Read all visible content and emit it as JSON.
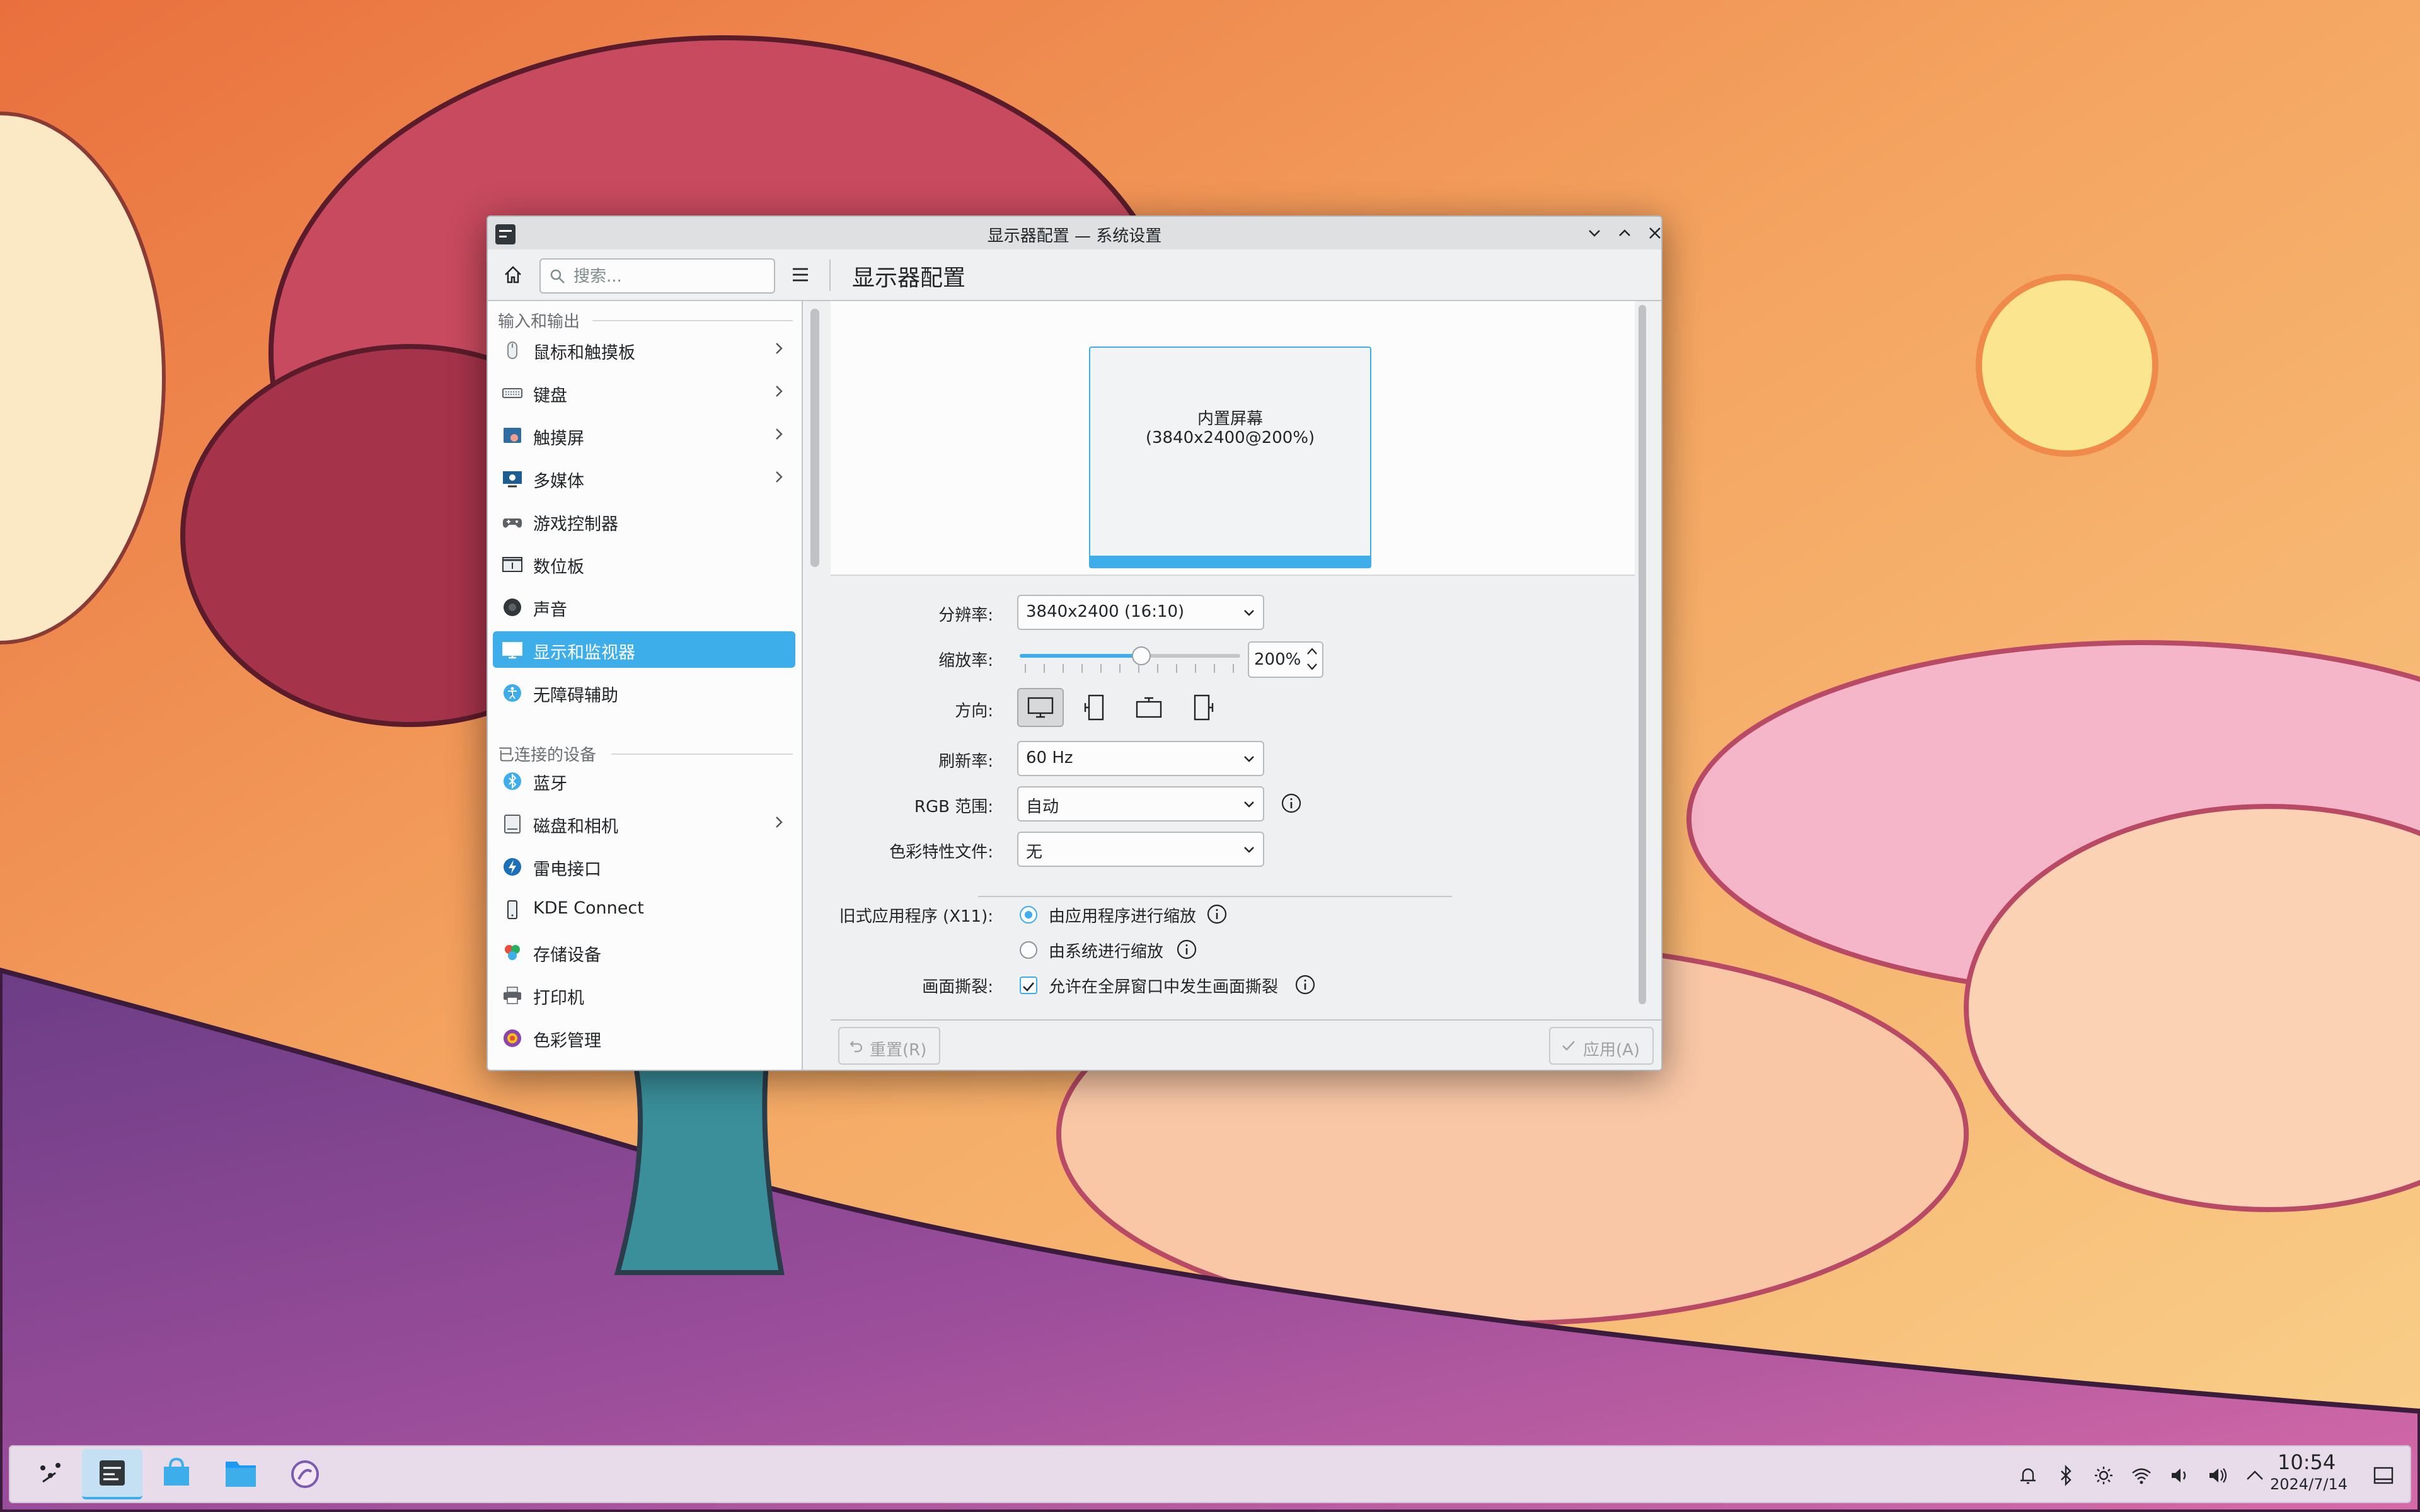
{
  "window": {
    "title": "显示器配置 — 系统设置",
    "page_title": "显示器配置",
    "search_placeholder": "搜索..."
  },
  "sidebar": {
    "section_input_output": "输入和输出",
    "section_connected": "已连接的设备",
    "items_io": [
      {
        "label": "鼠标和触摸板",
        "icon": "mouse-icon",
        "chevron": true
      },
      {
        "label": "键盘",
        "icon": "keyboard-icon",
        "chevron": true
      },
      {
        "label": "触摸屏",
        "icon": "touchscreen-icon",
        "chevron": true
      },
      {
        "label": "多媒体",
        "icon": "multimedia-icon",
        "chevron": true
      },
      {
        "label": "游戏控制器",
        "icon": "gamepad-icon",
        "chevron": false
      },
      {
        "label": "数位板",
        "icon": "tablet-icon",
        "chevron": false
      },
      {
        "label": "声音",
        "icon": "speaker-icon",
        "chevron": false
      },
      {
        "label": "显示和监视器",
        "icon": "display-icon",
        "chevron": false,
        "active": true
      },
      {
        "label": "无障碍辅助",
        "icon": "accessibility-icon",
        "chevron": false
      }
    ],
    "items_connected": [
      {
        "label": "蓝牙",
        "icon": "bluetooth-icon",
        "chevron": false
      },
      {
        "label": "磁盘和相机",
        "icon": "disk-icon",
        "chevron": true
      },
      {
        "label": "雷电接口",
        "icon": "thunderbolt-icon",
        "chevron": false
      },
      {
        "label": "KDE Connect",
        "icon": "phone-icon",
        "chevron": false
      },
      {
        "label": "存储设备",
        "icon": "storage-icon",
        "chevron": false
      },
      {
        "label": "打印机",
        "icon": "printer-icon",
        "chevron": false
      },
      {
        "label": "色彩管理",
        "icon": "color-icon",
        "chevron": false
      }
    ]
  },
  "preview": {
    "monitor_name": "内置屏幕",
    "monitor_res": "(3840x2400@200%)"
  },
  "settings": {
    "resolution_label": "分辨率:",
    "resolution_value": "3840x2400 (16:10)",
    "scale_label": "缩放率:",
    "scale_value": "200%",
    "scale_fraction": 0.55,
    "orientation_label": "方向:",
    "refresh_label": "刷新率:",
    "refresh_value": "60 Hz",
    "rgb_label": "RGB 范围:",
    "rgb_value": "自动",
    "color_profile_label": "色彩特性文件:",
    "color_profile_value": "无",
    "legacy_label": "旧式应用程序 (X11):",
    "legacy_option_app": "由应用程序进行缩放",
    "legacy_option_system": "由系统进行缩放",
    "tearing_label": "画面撕裂:",
    "tearing_option": "允许在全屏窗口中发生画面撕裂"
  },
  "buttons": {
    "reset": "重置(R)",
    "apply": "应用(A)"
  },
  "taskbar": {
    "time": "10:54",
    "date": "2024/7/14"
  },
  "colors": {
    "accent": "#3daee9",
    "taskbar": "#e8dcea"
  }
}
